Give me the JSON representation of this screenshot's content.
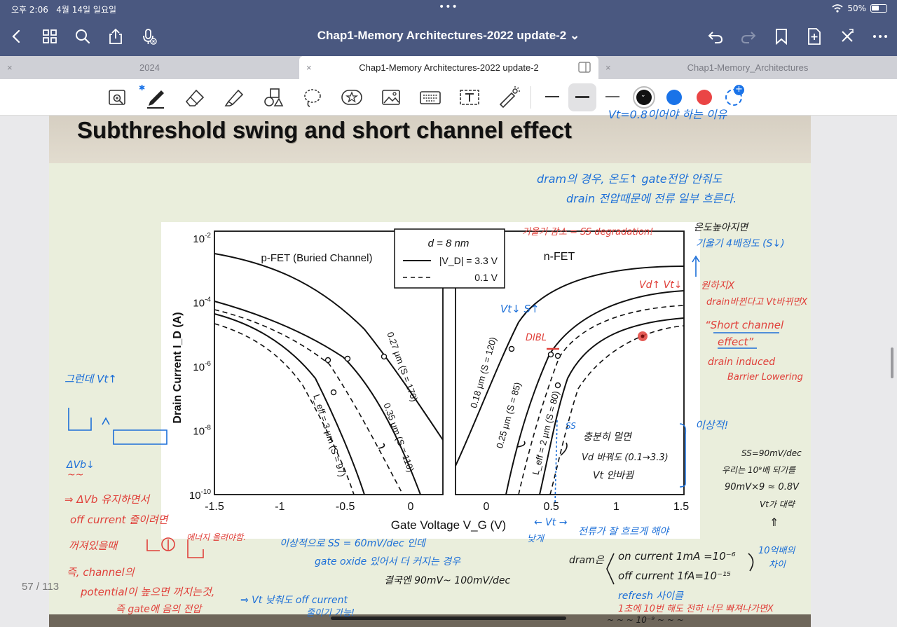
{
  "status_bar": {
    "time": "오후 2:06",
    "date": "4월 14일 일요일",
    "dots": "•••",
    "battery": "50%"
  },
  "nav": {
    "title": "Chap1-Memory Architectures-2022 update-2",
    "title_chevron": "⌄",
    "left_icons": [
      "back-icon",
      "grid-icon",
      "search-icon",
      "share-icon",
      "mic-icon"
    ],
    "right_icons": [
      "undo-icon",
      "redo-icon",
      "bookmark-icon",
      "add-page-icon",
      "close-icon",
      "more-icon"
    ]
  },
  "tabs": [
    {
      "label": "2024",
      "close": "×"
    },
    {
      "label": "Chap1-Memory Architectures-2022 update-2",
      "close": "×",
      "active": true
    },
    {
      "label": "Chap1-Memory_Architectures",
      "close": "×"
    }
  ],
  "toolbar": {
    "tools": [
      "zoom-box-icon",
      "pen-icon",
      "eraser-icon",
      "highlighter-icon",
      "shapes-icon",
      "lasso-icon",
      "sticker-icon",
      "image-icon",
      "keyboard-icon",
      "text-box-icon",
      "laser-pointer-icon"
    ],
    "bluetooth": "✱",
    "colors": [
      "#111111",
      "#1a73e8",
      "#ea4545"
    ],
    "add_color": "+"
  },
  "slide": {
    "title": "Subthreshold swing and short channel effect",
    "page_indicator": "57 / 113"
  },
  "chart_data": {
    "type": "line",
    "x": [],
    "ylabel": "Drain Current I_D (A)",
    "xlabel": "Gate Voltage V_G (V)",
    "y_ticks": [
      "10-2",
      "10-4",
      "10-6",
      "10-8",
      "10-10"
    ],
    "left_panel": {
      "title": "p-FET (Buried Channel)",
      "xlim": [
        -1.5,
        0
      ],
      "x_ticks": [
        "-1.5",
        "-1",
        "-0.5",
        "0"
      ]
    },
    "right_panel": {
      "title": "n-FET",
      "xlim": [
        0,
        1.5
      ],
      "x_ticks": [
        "0",
        "0.5",
        "1",
        "1.5"
      ]
    },
    "legend": {
      "d": "d = 8 nm",
      "solid": "|V_D| = 3.3 V",
      "dashed": "0.1 V"
    },
    "curve_labels": [
      "0.27 μm (S = 170)",
      "0.35 μm (S = 110)",
      "L_eff = 3 μm (S = 97)",
      "0.18 μm (S = 120)",
      "0.25 μm (S = 85)",
      "L_eff = 2 μm (S = 80)"
    ]
  },
  "annotations": {
    "t_top": "Vt=0.8이어야 하는 이유",
    "t_dram1": "dram의 경우, 온도↑ gate전압 안줘도",
    "t_dram2": "drain 전압때문에 전류 일부 흐른다.",
    "t_degr": "기울기 감소 = SS degradation!",
    "t_temp1": "온도높아지면",
    "t_temp2": "기울기 4배정도 (S↓)",
    "t_vdvt": "Vd↑ Vt↓",
    "t_ideal": "원하지X",
    "t_drainvt": "drain바뀐다고 Vt바뀌면X",
    "t_sce1": "“Short channel",
    "t_sce2": "effect”",
    "t_dibl1": "drain induced",
    "t_dibl2": "Barrier Lowering",
    "t_vts": "Vt↓ S↑",
    "t_dibl": "DIBL",
    "t_ss": "SS",
    "t_ideal2": "이상적!",
    "t_enough1": "충분히 멀면",
    "t_enough2": "Vd 바꿔도 (0.1→3.3)",
    "t_enough3": "Vt 안바뀜",
    "t_ssval1": "SS=90mV/dec",
    "t_ssval2": "우리는 10⁹배 되기를",
    "t_ssval3": "90mV×9 ≈ 0.8V",
    "t_ssval4": "Vt가 대략",
    "t_ssval5": "⇑",
    "t_left1": "그런데 Vt↑",
    "t_left2": "ΔVb↓",
    "t_left3": "~~",
    "t_left4": "⇒ ΔVb 유지하면서",
    "t_left5": "off current 줄이려면",
    "t_left6": "꺼져있을때",
    "t_left7": "에너지 올려야함.",
    "t_left8": "즉, channel의",
    "t_left9": "potential이 높으면 꺼지는것,",
    "t_left10": "즉 gate에 음의 전압",
    "t_bot1": "⇒ Vt 낮춰도 off current",
    "t_bot2": "줄이기 가능!",
    "t_ideal3": "이상적으로 SS = 60mV/dec 인데",
    "t_oxide": "gate oxide 있어서 더 커지는 경우",
    "t_result": "결국엔 90mV~ 100mV/dec",
    "t_arrowvt": "← Vt →",
    "t_low": "낮게",
    "t_flow": "전류가 잘 흐르게 해야",
    "t_dramc": "dram은",
    "t_oncur": "on current 1mA =10⁻⁶",
    "t_offcur": "off current 1fA=10⁻¹⁵",
    "t_diff1": "10억배의",
    "t_diff2": "차이",
    "t_refresh": "refresh 사이클",
    "t_last": "1초에 10번 해도 전하 너무 빠져나가면X",
    "t_last2": "~ ~ ~ 10⁻⁹ ~ ~ ~"
  },
  "colors": {
    "nav_bg": "#4a5880",
    "ink_blue": "#1c6fd8",
    "ink_red": "#e0403a",
    "page_bg": "#eaeedc"
  }
}
